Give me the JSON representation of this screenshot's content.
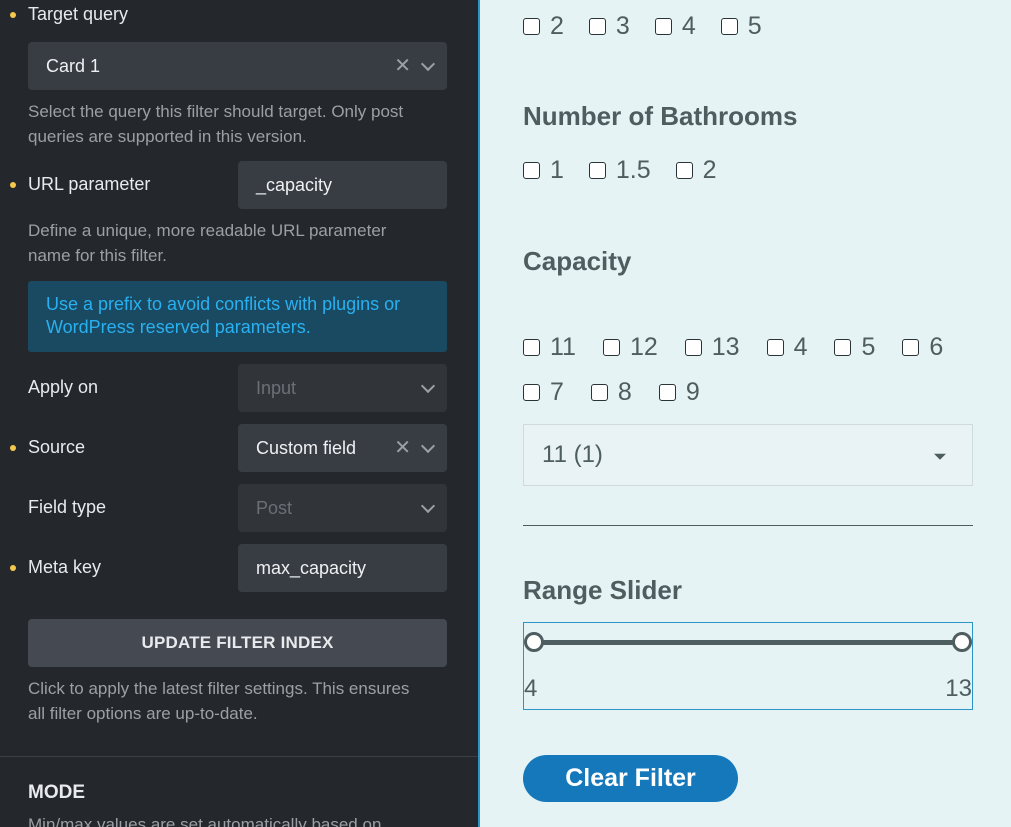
{
  "panel": {
    "target_query": {
      "label": "Target query",
      "value": "Card 1",
      "description": "Select the query this filter should target. Only post queries are supported in this version."
    },
    "url_parameter": {
      "label": "URL parameter",
      "value": "_capacity",
      "description": "Define a unique, more readable URL parameter name for this filter."
    },
    "notice": "Use a prefix to avoid conflicts with plugins or WordPress reserved parameters.",
    "apply_on": {
      "label": "Apply on",
      "value": "Input"
    },
    "source": {
      "label": "Source",
      "value": "Custom field"
    },
    "field_type": {
      "label": "Field type",
      "value": "Post"
    },
    "meta_key": {
      "label": "Meta key",
      "value": "max_capacity"
    },
    "update_button": "UPDATE FILTER INDEX",
    "update_description": "Click to apply the latest filter settings. This ensures all filter options are up-to-date.",
    "mode_heading": "MODE",
    "mode_description": "Min/max values are set automatically based on"
  },
  "preview": {
    "top_options": [
      "2",
      "3",
      "4",
      "5"
    ],
    "bathrooms": {
      "heading": "Number of Bathrooms",
      "options": [
        "1",
        "1.5",
        "2"
      ]
    },
    "capacity": {
      "heading": "Capacity",
      "options_row1": [
        "11",
        "12",
        "13",
        "4",
        "5",
        "6"
      ],
      "options_row2": [
        "7",
        "8",
        "9"
      ]
    },
    "select_value": "11 (1)",
    "range_slider": {
      "heading": "Range Slider",
      "min": "4",
      "max": "13"
    },
    "clear_button": "Clear Filter"
  },
  "colors": {
    "panel_bg": "#24272b",
    "preview_bg": "#e6f3f5",
    "accent_blue": "#1478bb",
    "required_dot": "#f2c94c",
    "notice_text": "#29b0f0"
  }
}
